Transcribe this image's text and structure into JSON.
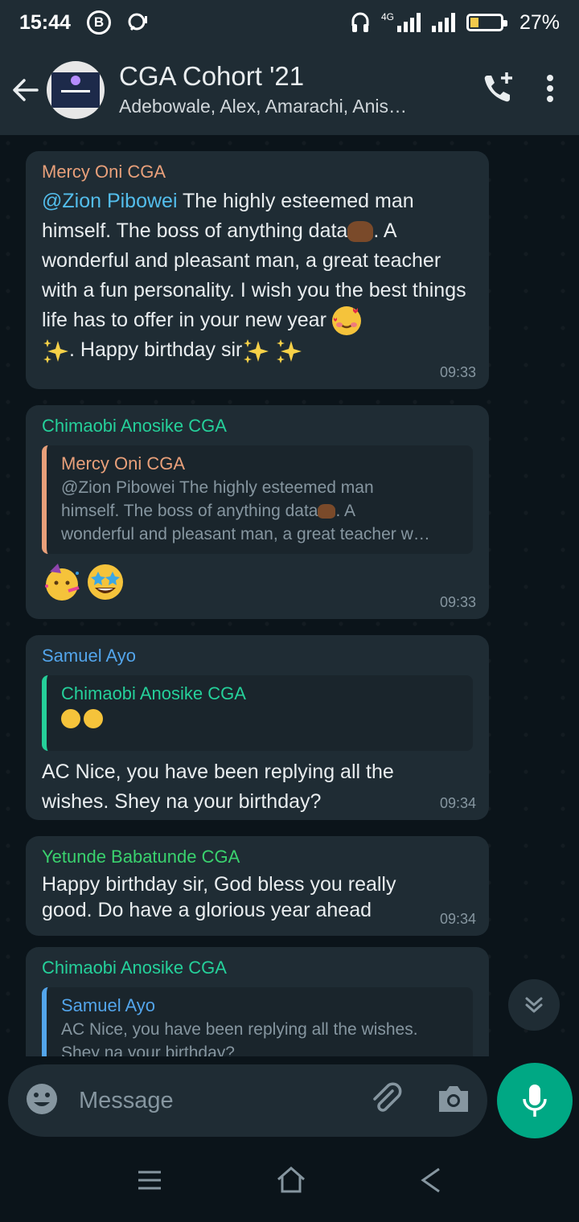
{
  "status_bar": {
    "time": "15:44",
    "b_label": "B",
    "network": "4G",
    "battery": "27%",
    "battery_level": 0.27
  },
  "header": {
    "title": "CGA Cohort '21",
    "members": "Adebowale, Alex, Amarachi, Anis…",
    "icons": [
      "back-arrow-icon",
      "add-call-icon",
      "more-vert-icon"
    ]
  },
  "messages": [
    {
      "sender": "Mercy Oni CGA",
      "sender_color": "#e9a07a",
      "mention": "@Zion Pibowei",
      "text_1": " The highly esteemed man himself. The boss of anything data",
      "text_2": ". A wonderful and pleasant man, a great teacher with a fun personality.  I wish you the best things life has to offer in your new year ",
      "text_3": ". Happy birthday sir",
      "time": "09:33"
    },
    {
      "sender": "Chimaobi Anosike CGA",
      "sender_color": "#25d09a",
      "quote_sender": "Mercy Oni CGA",
      "quote_color": "#e9a07a",
      "quote_line1": "@Zion Pibowei The highly esteemed man",
      "quote_line2": "himself. The boss of anything data",
      "quote_line2b": ". A",
      "quote_line3": "wonderful and pleasant man, a great teacher w…",
      "time": "09:33"
    },
    {
      "sender": "Samuel Ayo",
      "sender_color": "#53a5eb",
      "quote_sender": "Chimaobi Anosike CGA",
      "quote_color": "#25d09a",
      "text": "AC Nice, you have been replying all the wishes. Shey na your birthday?",
      "time": "09:34"
    },
    {
      "sender": "Yetunde Babatunde CGA",
      "sender_color": "#3ad26e",
      "text": "Happy birthday sir, God bless you really good. Do have a glorious year ahead",
      "time": "09:34"
    },
    {
      "sender": "Chimaobi Anosike CGA",
      "sender_color": "#25d09a",
      "quote_sender": "Samuel Ayo",
      "quote_color": "#53a5eb",
      "quote_line1": "AC Nice, you have been replying all the wishes.",
      "quote_line2": "Shey na your birthday?"
    }
  ],
  "input": {
    "placeholder": "Message",
    "icons": [
      "emoji-icon",
      "attach-icon",
      "camera-icon",
      "mic-icon"
    ]
  },
  "nav": {
    "icons": [
      "menu-icon",
      "home-icon",
      "back-icon"
    ]
  },
  "colors": {
    "accent": "#00a884",
    "bubble": "#1f2c34",
    "background": "#0b141a"
  }
}
